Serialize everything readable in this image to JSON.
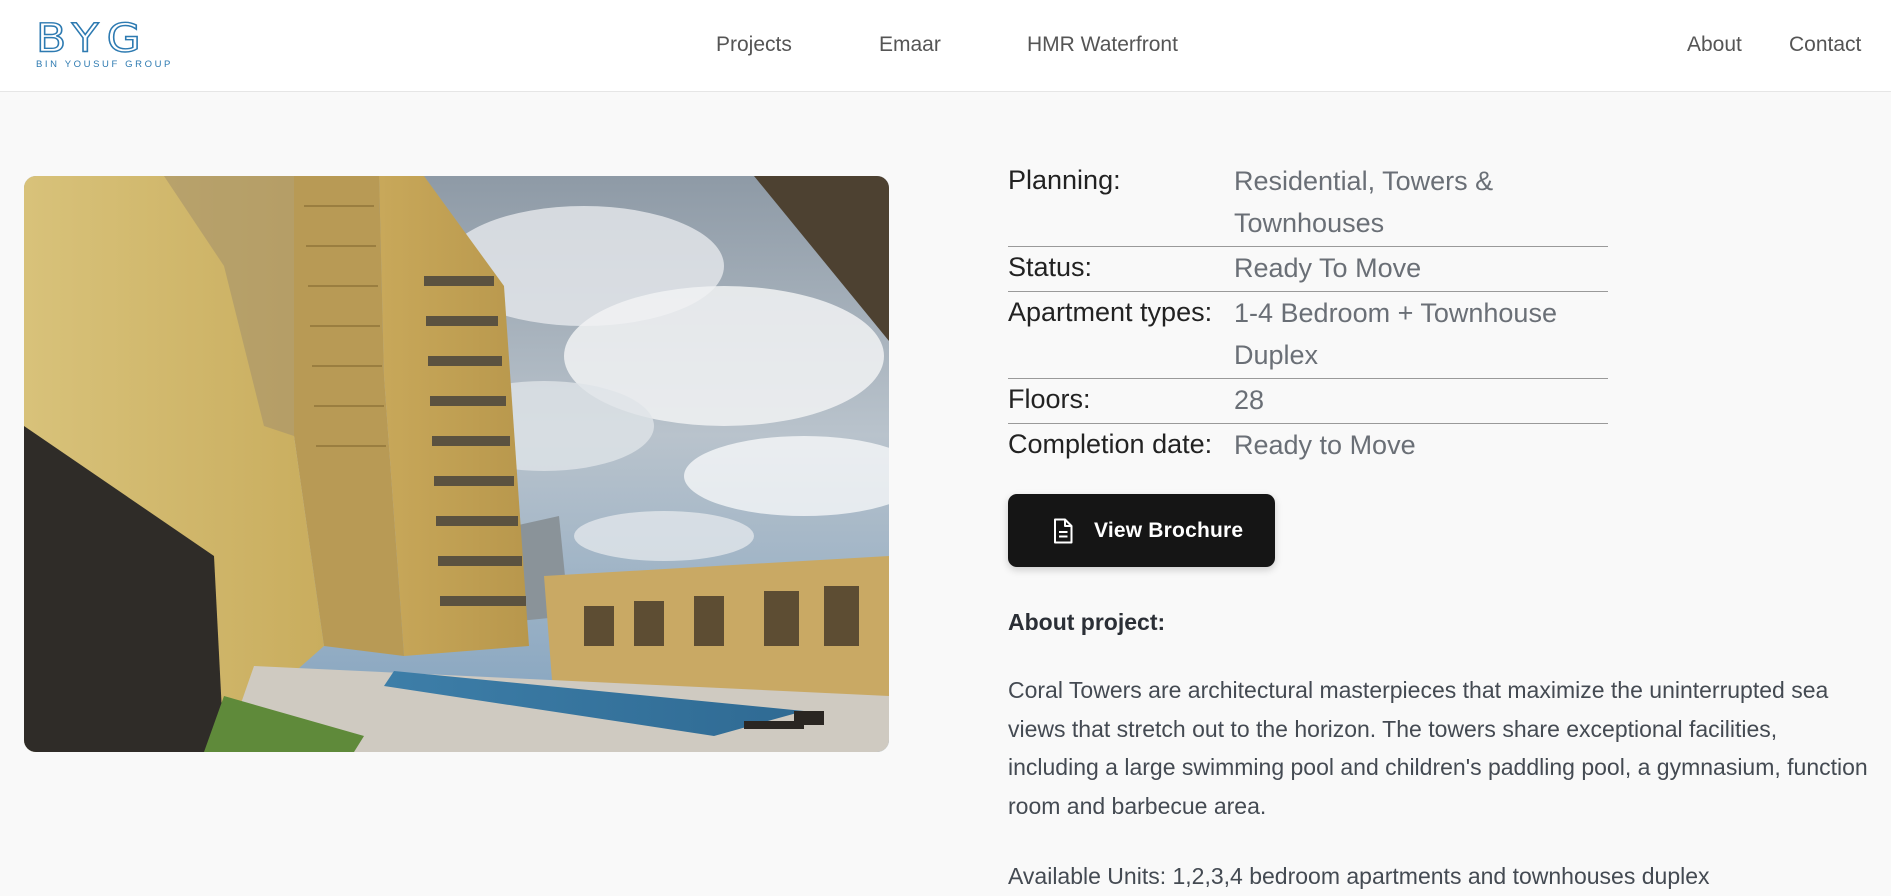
{
  "brand": {
    "logo_mark": "BYG",
    "logo_sub": "BIN YOUSUF GROUP"
  },
  "nav": {
    "center": [
      "Projects",
      "Emaar",
      "HMR Waterfront"
    ],
    "right": [
      "About",
      "Contact"
    ]
  },
  "specs": [
    {
      "label": "Planning:",
      "value": "Residential, Towers & Townhouses"
    },
    {
      "label": "Status:",
      "value": "Ready To Move"
    },
    {
      "label": "Apartment types:",
      "value": "1-4 Bedroom + Townhouse Duplex"
    },
    {
      "label": "Floors:",
      "value": "28"
    },
    {
      "label": "Completion date:",
      "value": "Ready to Move"
    }
  ],
  "brochure_button": {
    "label": "View Brochure",
    "icon": "document-icon"
  },
  "about": {
    "heading": "About project:",
    "text": "Coral Towers are architectural masterpieces that maximize the uninterrupted sea views that stretch out to the horizon. The towers share exceptional facilities, including a large swimming pool and children's paddling pool, a gymnasium, function room and barbecue area.",
    "extra": "Available Units: 1,2,3,4 bedroom apartments and townhouses duplex"
  },
  "colors": {
    "brand_blue": "#2d7ab1",
    "button_bg": "#151515",
    "value_text": "#6a6f76"
  }
}
